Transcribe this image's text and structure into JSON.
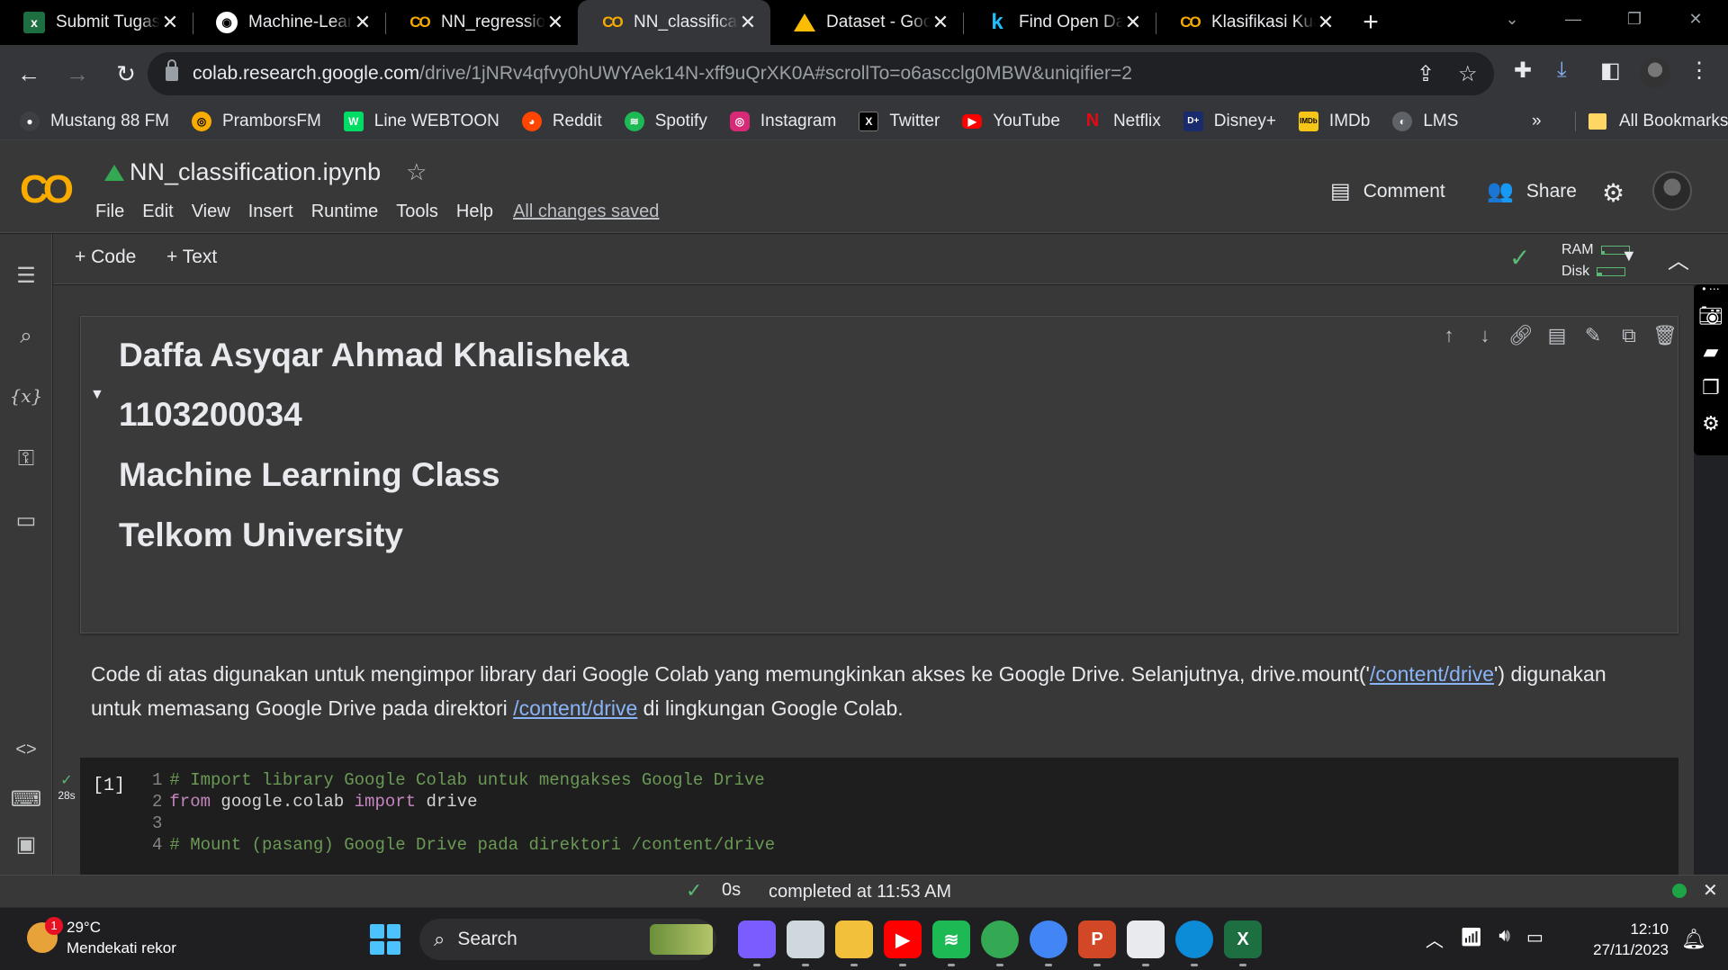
{
  "browser": {
    "tabs": [
      {
        "title": "Submit Tugas",
        "favicon": "excel-icon",
        "active": false
      },
      {
        "title": "Machine-Learn",
        "favicon": "github-icon",
        "active": false
      },
      {
        "title": "NN_regression",
        "favicon": "colab-icon",
        "active": false
      },
      {
        "title": "NN_classificati",
        "favicon": "colab-icon",
        "active": true
      },
      {
        "title": "Dataset - Goo",
        "favicon": "google-drive-icon",
        "active": false
      },
      {
        "title": "Find Open Dat",
        "favicon": "kaggle-icon",
        "active": false
      },
      {
        "title": "Klasifikasi Kua",
        "favicon": "colab-icon",
        "active": false
      }
    ],
    "url_host": "colab.research.google.com",
    "url_path": "/drive/1jNRv4qfvy0hUWYAek14N-xff9uQrXK0A#scrollTo=o6ascclg0MBW&uniqifier=2",
    "bookmarks": [
      {
        "label": "Mustang 88 FM",
        "icon": "radio-icon",
        "color": "#e8eaed"
      },
      {
        "label": "PramborsFM",
        "icon": "prambors-icon",
        "color": "#f9ab00"
      },
      {
        "label": "Line WEBTOON",
        "icon": "webtoon-icon",
        "color": "#00dc64"
      },
      {
        "label": "Reddit",
        "icon": "reddit-icon",
        "color": "#ff4500"
      },
      {
        "label": "Spotify",
        "icon": "spotify-icon",
        "color": "#1db954"
      },
      {
        "label": "Instagram",
        "icon": "instagram-icon",
        "color": "#d62976"
      },
      {
        "label": "Twitter",
        "icon": "x-icon",
        "color": "#000000"
      },
      {
        "label": "YouTube",
        "icon": "youtube-icon",
        "color": "#ff0000"
      },
      {
        "label": "Netflix",
        "icon": "netflix-icon",
        "color": "#e50914"
      },
      {
        "label": "Disney+",
        "icon": "disney-icon",
        "color": "#1a2b6d"
      },
      {
        "label": "IMDb",
        "icon": "imdb-icon",
        "color": "#f5c518"
      },
      {
        "label": "LMS",
        "icon": "lms-icon",
        "color": "#5f6368"
      }
    ],
    "bookmarks_overflow": "»",
    "all_bookmarks": "All Bookmarks"
  },
  "colab": {
    "logo": "CO",
    "notebook_title": "NN_classification.ipynb",
    "menu": [
      "File",
      "Edit",
      "View",
      "Insert",
      "Runtime",
      "Tools",
      "Help"
    ],
    "save_status": "All changes saved",
    "comment_label": "Comment",
    "share_label": "Share",
    "add_code": "+ Code",
    "add_text": "+ Text",
    "ram_label": "RAM",
    "disk_label": "Disk",
    "ram_fraction": 0.1,
    "disk_fraction": 0.15
  },
  "notebook": {
    "heading_lines": [
      "Daffa Asyqar Ahmad Khalisheka",
      "1103200034",
      "Machine Learning Class",
      "Telkom University"
    ],
    "description_part1": "Code di atas digunakan untuk mengimpor library dari Google Colab yang memungkinkan akses ke Google Drive. Selanjutnya, drive.mount('",
    "description_link1": "/content/drive",
    "description_part2": "') digunakan untuk memasang Google Drive pada direktori ",
    "description_link2": "/content/drive",
    "description_part3": " di lingkungan Google Colab.",
    "code_cell": {
      "exec_count": "[1]",
      "run_time": "28s",
      "lines": [
        {
          "no": "1",
          "comment": "# Import library Google Colab untuk mengakses Google Drive"
        },
        {
          "no": "2",
          "kw1": "from",
          "mid": " google.colab ",
          "kw2": "import",
          "end": " drive"
        },
        {
          "no": "3"
        },
        {
          "no": "4",
          "comment": "# Mount (pasang) Google Drive pada direktori /content/drive"
        }
      ]
    }
  },
  "statusbar": {
    "duration": "0s",
    "completed": "completed at 11:53 AM"
  },
  "taskbar": {
    "weather_temp": "29°C",
    "weather_desc": "Mendekati rekor",
    "weather_badge": "1",
    "search_label": "Search",
    "time": "12:10",
    "date": "27/11/2023",
    "apps": [
      {
        "name": "copilot-icon",
        "color": "#7b5cff",
        "label": ""
      },
      {
        "name": "task-view-icon",
        "color": "#cfd8dc",
        "label": ""
      },
      {
        "name": "file-explorer-icon",
        "color": "#f3c03c",
        "label": ""
      },
      {
        "name": "youtube-app-icon",
        "color": "#ff0000",
        "label": "▶"
      },
      {
        "name": "spotify-app-icon",
        "color": "#1db954",
        "label": "≋"
      },
      {
        "name": "chrome-profile-b-icon",
        "color": "#34a853",
        "label": ""
      },
      {
        "name": "chrome-profile-icon",
        "color": "#4285f4",
        "label": ""
      },
      {
        "name": "powerpoint-icon",
        "color": "#d24726",
        "label": "P"
      },
      {
        "name": "snipping-tool-icon",
        "color": "#e8eaed",
        "label": ""
      },
      {
        "name": "edge-icon",
        "color": "#0c8bd6",
        "label": ""
      },
      {
        "name": "excel-app-icon",
        "color": "#1d6f42",
        "label": "X"
      }
    ]
  }
}
